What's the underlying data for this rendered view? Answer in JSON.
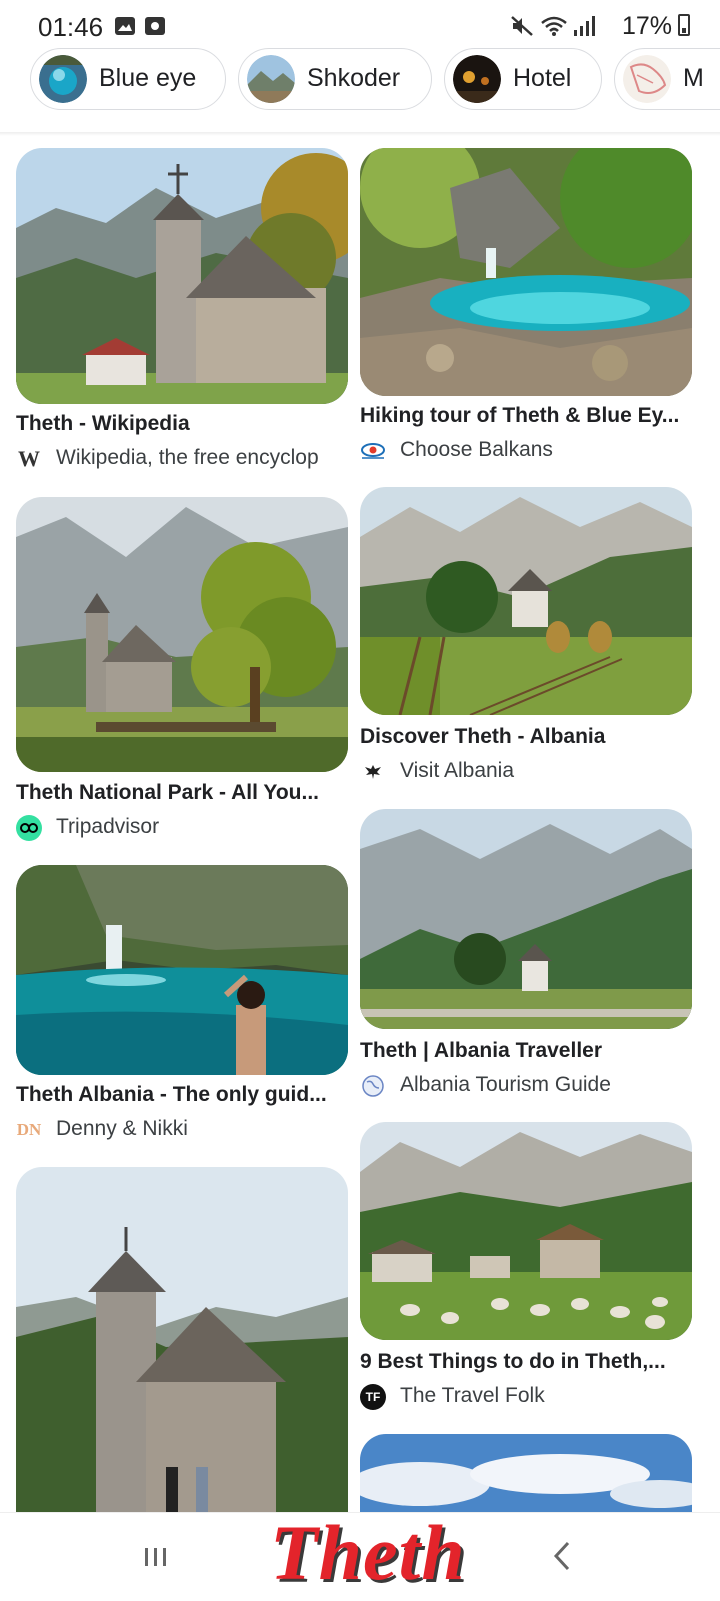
{
  "status_bar": {
    "time": "01:46",
    "battery": "17%"
  },
  "chips": [
    {
      "label": "Blue eye"
    },
    {
      "label": "Shkoder"
    },
    {
      "label": "Hotel"
    },
    {
      "label": "M"
    }
  ],
  "results": [
    {
      "title": "Theth - Wikipedia",
      "source": "Wikipedia, the free encyclop",
      "source_icon": "W"
    },
    {
      "title": "Hiking tour of Theth & Blue Ey...",
      "source": "Choose Balkans",
      "source_icon": "eye-logo-icon"
    },
    {
      "title": "Theth National Park - All You...",
      "source": "Tripadvisor",
      "source_icon": "owl-icon"
    },
    {
      "title": "Discover Theth - Albania",
      "source": "Visit Albania",
      "source_icon": "eagle-icon"
    },
    {
      "title": "Theth Albania - The only guid...",
      "source": "Denny & Nikki",
      "source_icon": "DN"
    },
    {
      "title": "Theth | Albania Traveller",
      "source": "Albania Tourism Guide",
      "source_icon": "globe-icon"
    },
    {
      "title": "9 Best Things to do in Theth,...",
      "source": "The Travel Folk",
      "source_icon": "TF"
    }
  ],
  "overlay_text": "Theth"
}
